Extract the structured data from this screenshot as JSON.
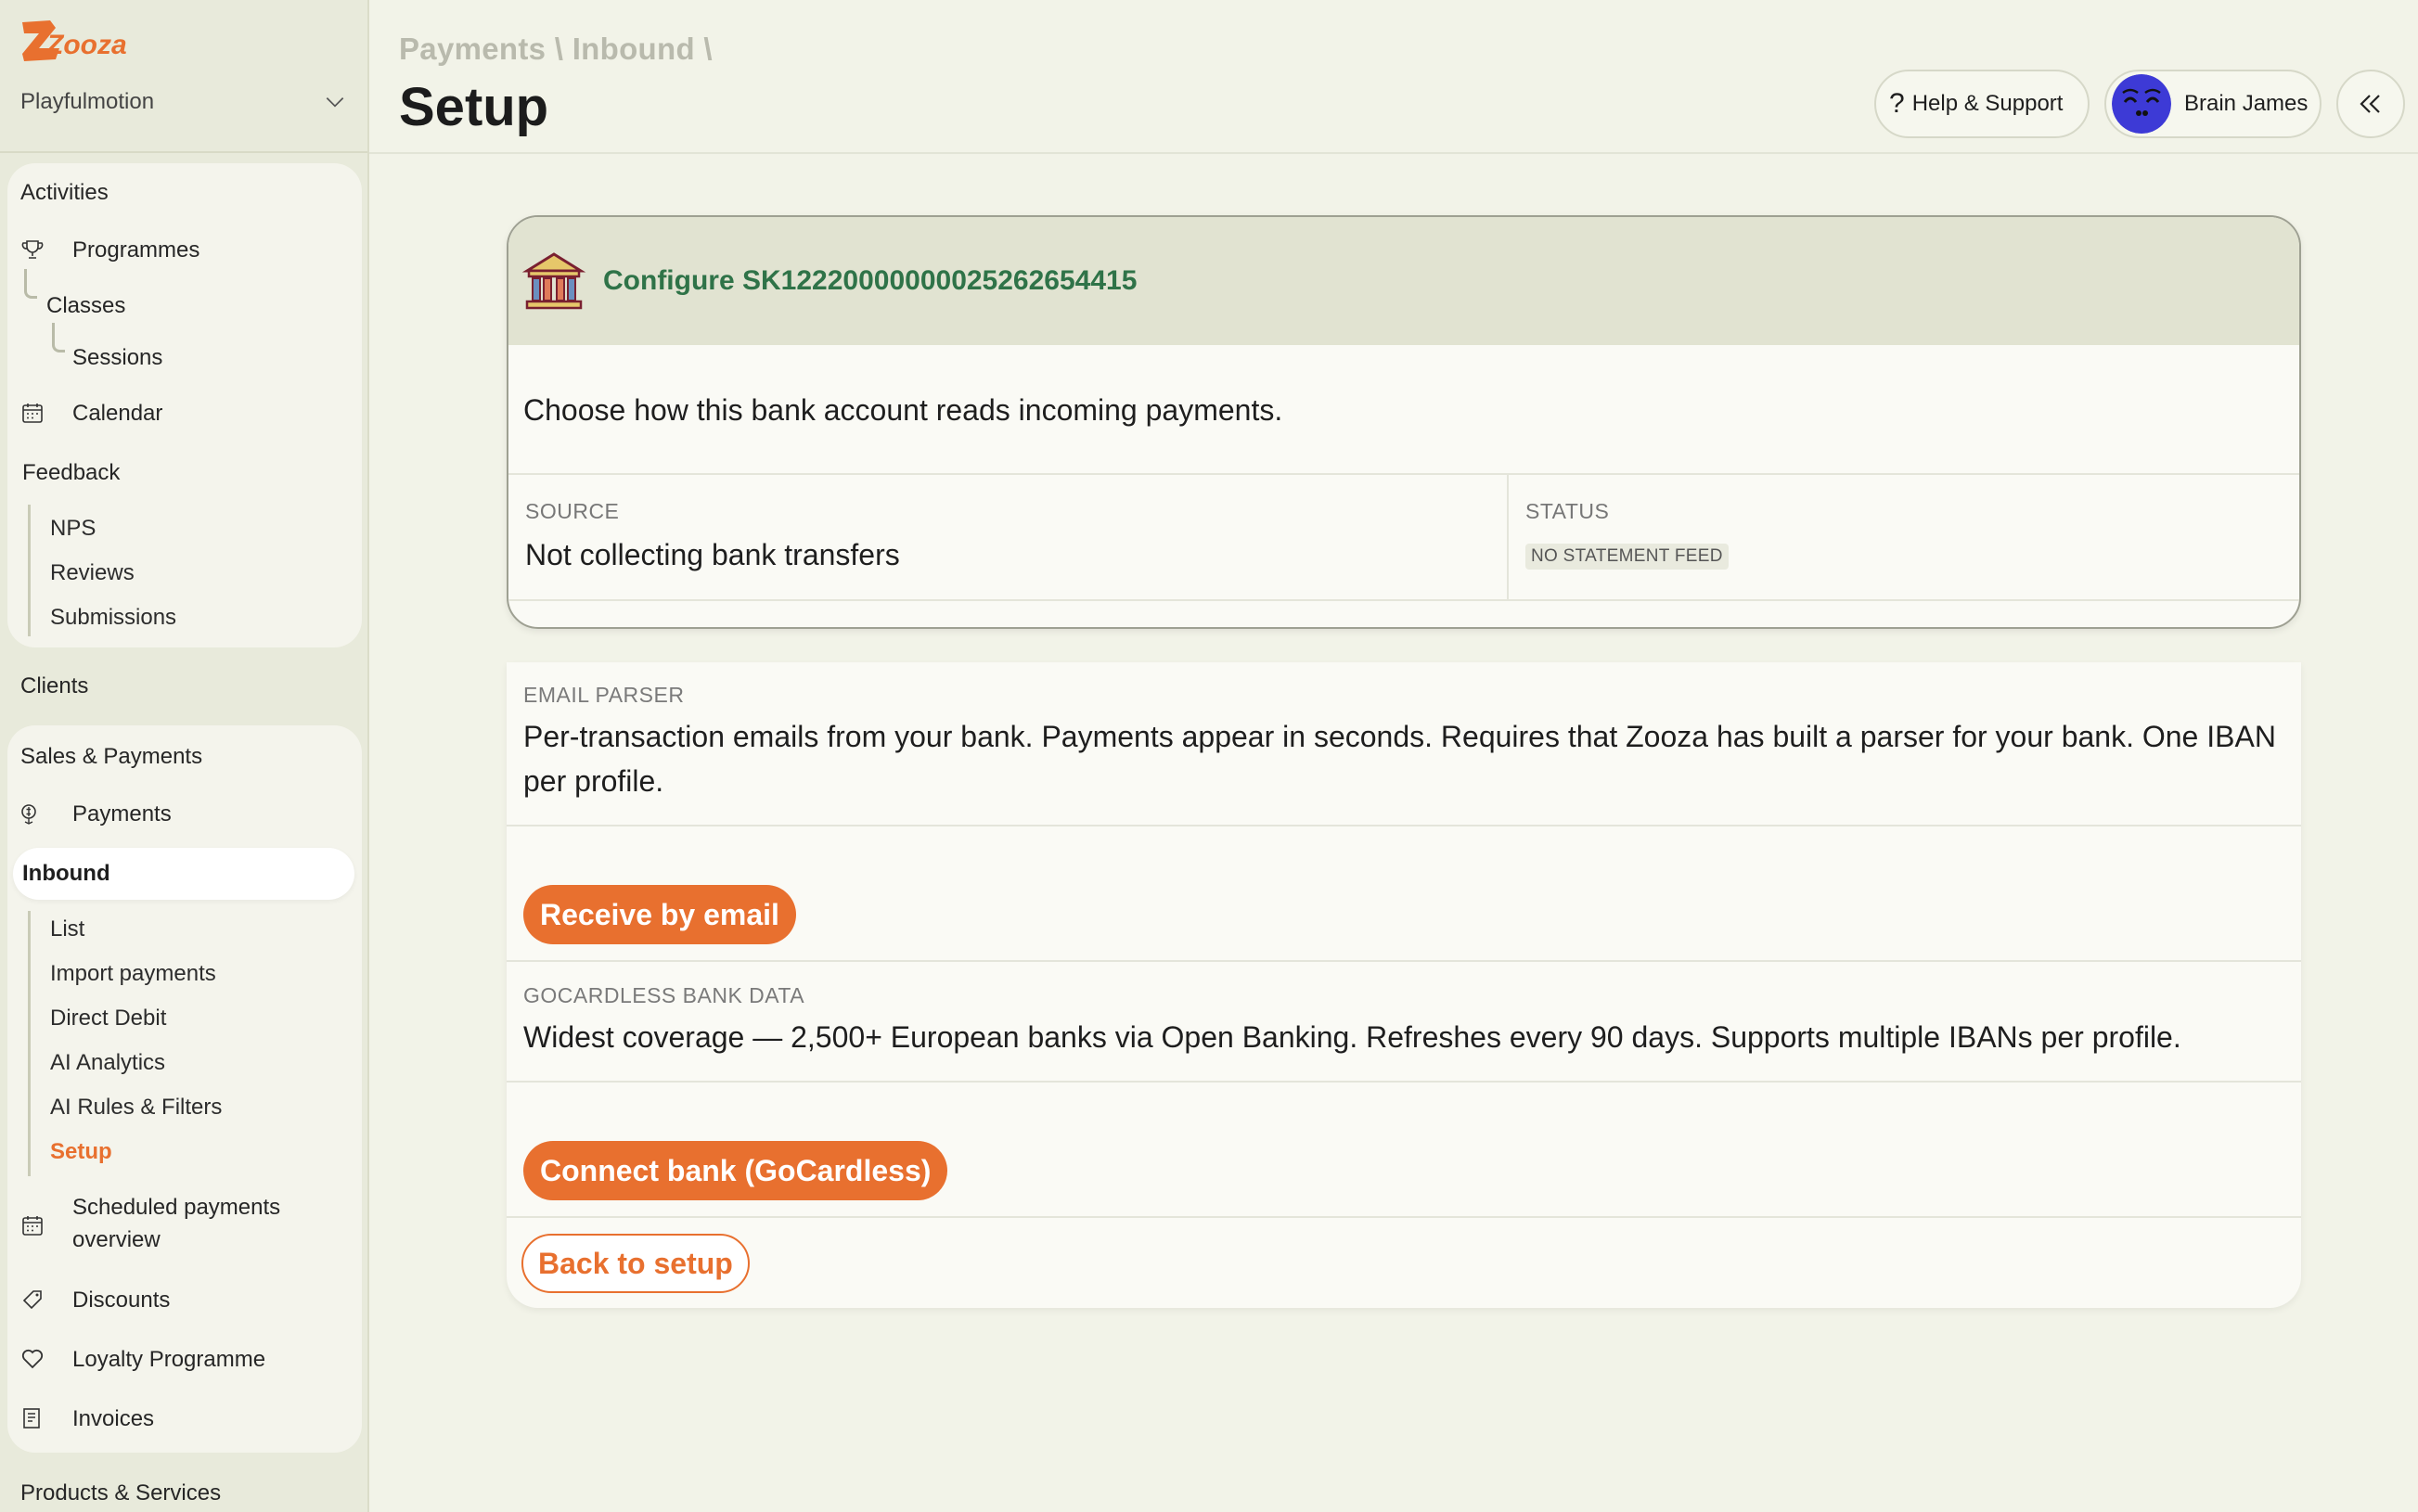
{
  "app": {
    "logo_text": "Zooza",
    "org_name": "Playfulmotion"
  },
  "sidebar": {
    "activities": {
      "heading": "Activities",
      "programmes": "Programmes",
      "classes": "Classes",
      "sessions": "Sessions",
      "calendar": "Calendar",
      "feedback": "Feedback",
      "nps": "NPS",
      "reviews": "Reviews",
      "submissions": "Submissions"
    },
    "clients": "Clients",
    "sales": {
      "heading": "Sales & Payments",
      "payments": "Payments",
      "inbound": "Inbound",
      "list": "List",
      "import_payments": "Import payments",
      "direct_debit": "Direct Debit",
      "ai_analytics": "AI Analytics",
      "ai_rules": "AI Rules & Filters",
      "setup": "Setup",
      "scheduled_line1": "Scheduled payments",
      "scheduled_line2": "overview",
      "discounts": "Discounts",
      "loyalty": "Loyalty Programme",
      "invoices": "Invoices"
    },
    "products": "Products & Services"
  },
  "header": {
    "breadcrumb": [
      "Payments",
      "Inbound"
    ],
    "separator": "\\",
    "title": "Setup",
    "help_label": "Help & Support",
    "user_name": "Brain James"
  },
  "config": {
    "title": "Configure SK1222000000002526265441 5",
    "description": "Choose how this bank account reads incoming payments.",
    "source_label": "SOURCE",
    "source_value": "Not collecting bank transfers",
    "status_label": "STATUS",
    "status_value": "NO STATEMENT FEED"
  },
  "email_parser": {
    "label": "EMAIL PARSER",
    "text": "Per-transaction emails from your bank. Payments appear in seconds. Requires that Zooza has built a parser for your bank. One IBAN per profile.",
    "button": "Receive by email"
  },
  "gocardless": {
    "label": "GOCARDLESS BANK DATA",
    "text": "Widest coverage — 2,500+ European banks via Open Banking. Refreshes every 90 days. Supports multiple IBANs per profile.",
    "button": "Connect bank (GoCardless)"
  },
  "back_button": "Back to setup",
  "colors": {
    "accent": "#e8702f",
    "title_green": "#2f7348",
    "sidebar_bg": "#e8eadb"
  },
  "icons": [
    "zooza-logo",
    "chevron-down-icon",
    "trophy-icon",
    "calendar-icon",
    "money-icon",
    "scheduled-calendar-icon",
    "tag-icon",
    "heart-icon",
    "invoice-icon",
    "question-icon",
    "avatar",
    "double-chevron-left-icon",
    "bank-icon"
  ]
}
